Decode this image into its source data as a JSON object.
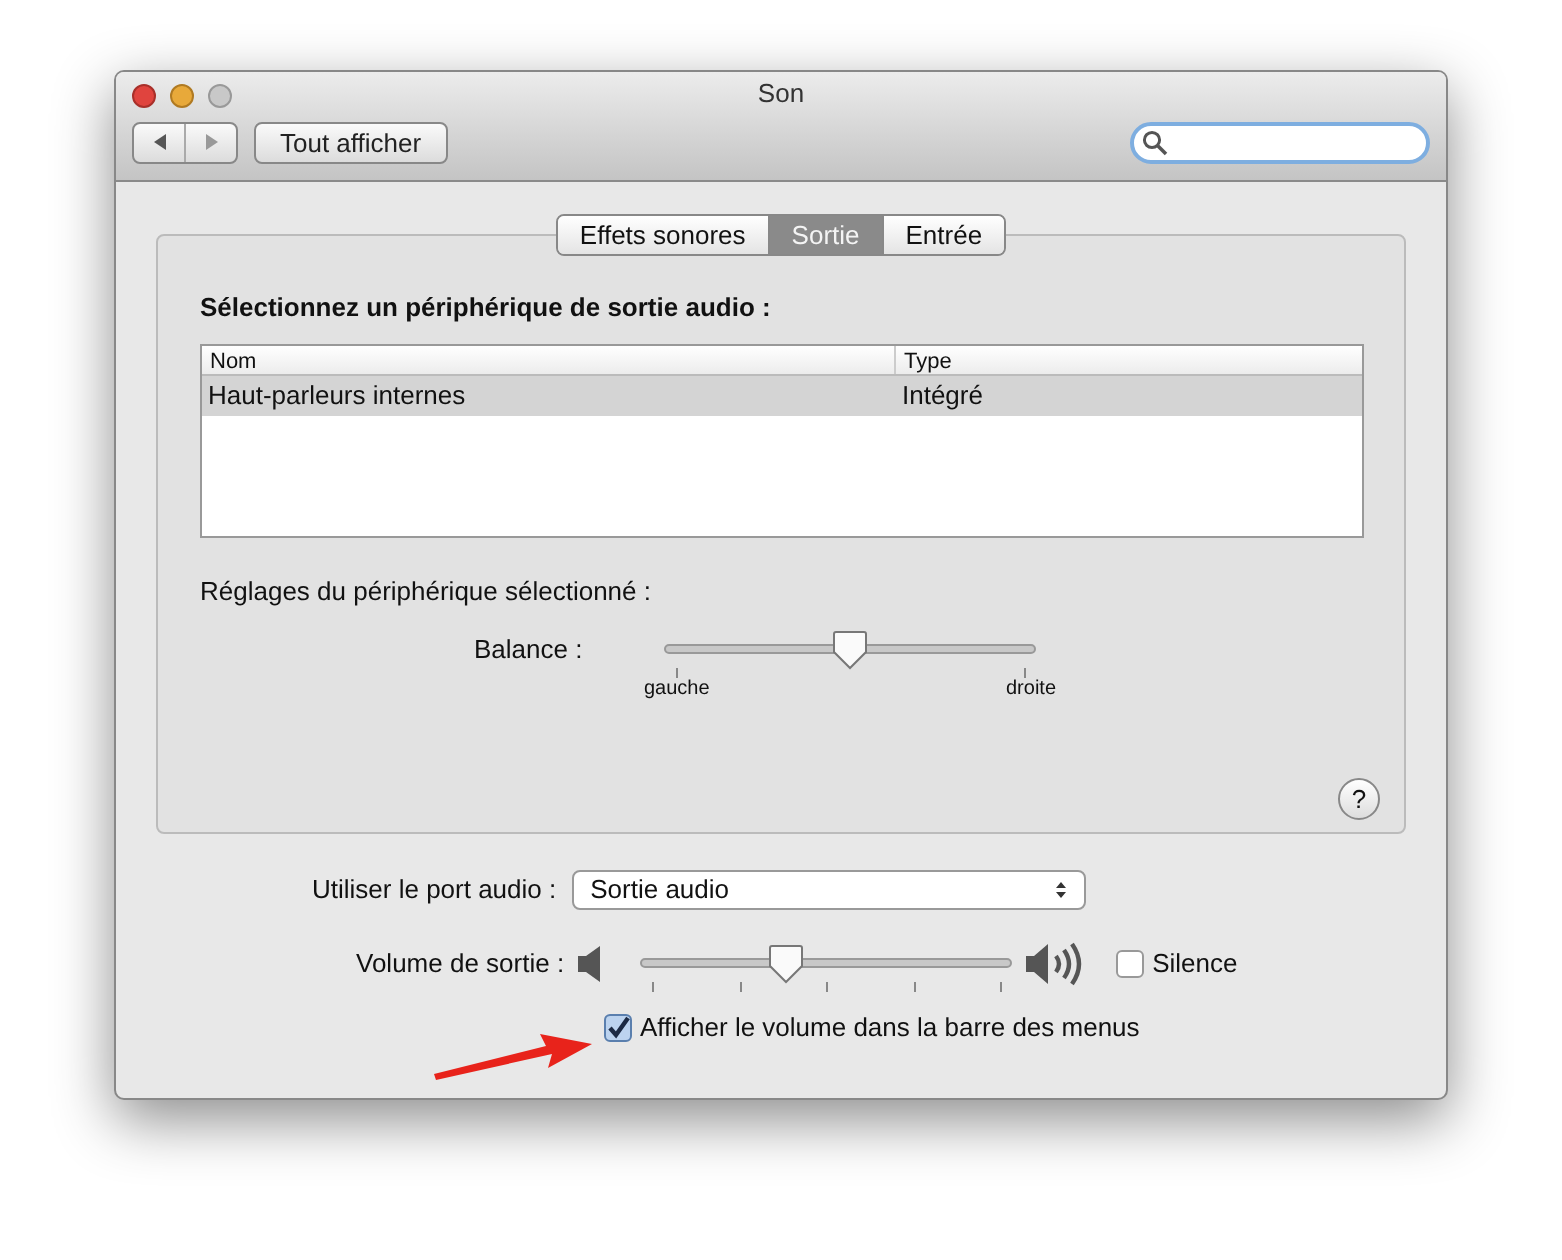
{
  "window": {
    "title": "Son"
  },
  "toolbar": {
    "show_all": "Tout afficher"
  },
  "tabs": [
    {
      "label": "Effets sonores",
      "selected": false
    },
    {
      "label": "Sortie",
      "selected": true
    },
    {
      "label": "Entrée",
      "selected": false
    }
  ],
  "device_heading": "Sélectionnez un périphérique de sortie audio :",
  "table": {
    "columns": [
      "Nom",
      "Type"
    ],
    "rows": [
      {
        "cells": [
          "Haut-parleurs internes",
          "Intégré"
        ],
        "selected": true
      }
    ]
  },
  "settings_heading": "Réglages du périphérique sélectionné :",
  "balance": {
    "label": "Balance :",
    "level": 0.5,
    "left": "gauche",
    "right": "droite"
  },
  "port": {
    "label": "Utiliser le port audio :",
    "value": "Sortie audio"
  },
  "volume": {
    "label": "Volume de sortie :",
    "level": 0.38,
    "mute_label": "Silence",
    "muted": false
  },
  "show_in_menu": {
    "label": "Afficher le volume dans la barre des menus",
    "checked": true
  },
  "help": "?"
}
